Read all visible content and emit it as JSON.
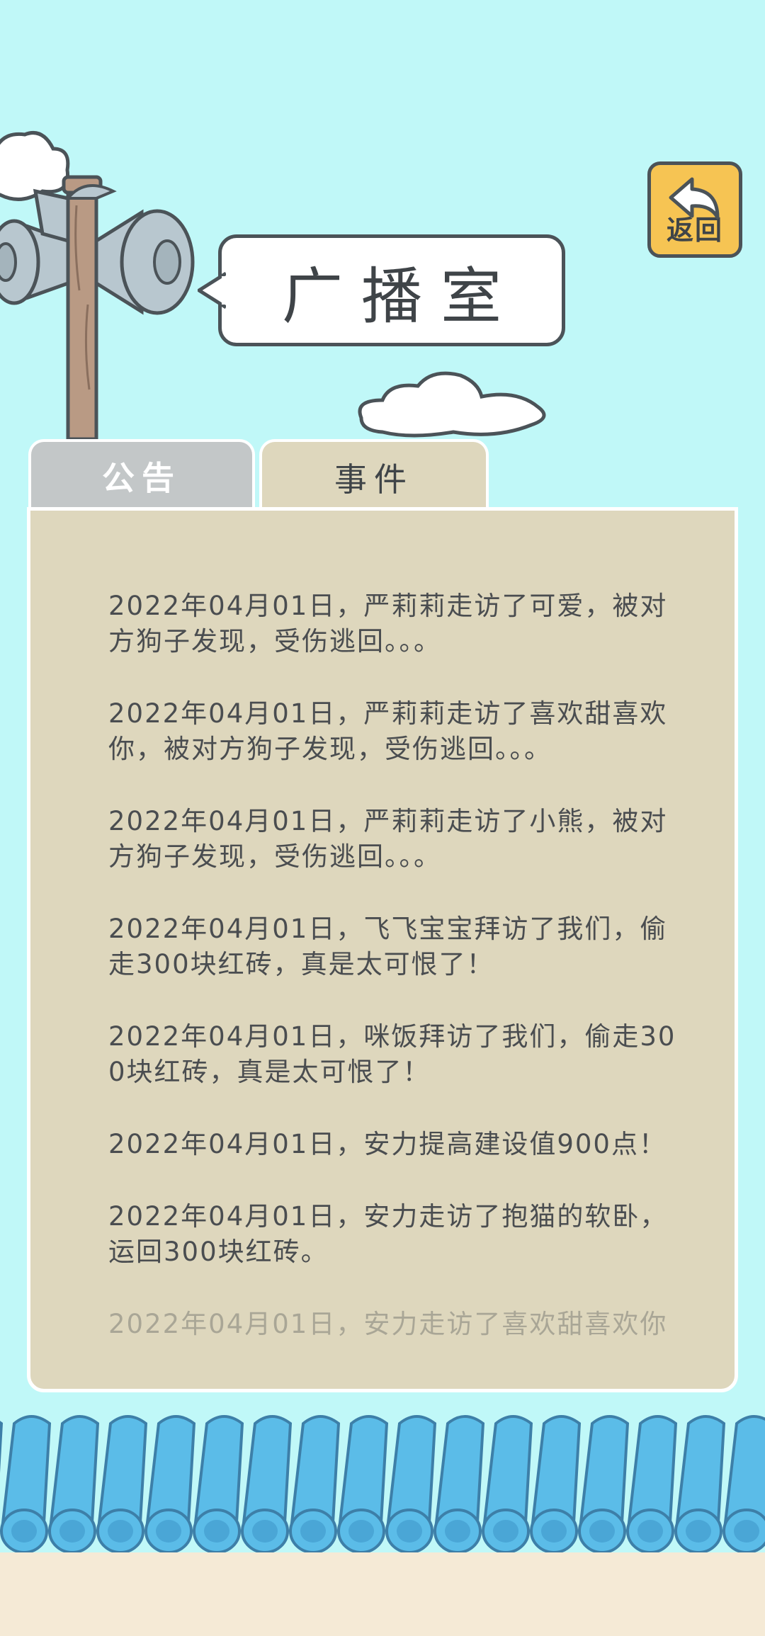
{
  "header": {
    "title": "广播室",
    "back_label": "返回"
  },
  "tabs": [
    {
      "label": "公告",
      "active": false
    },
    {
      "label": "事件",
      "active": true
    }
  ],
  "events": [
    "2022年04月01日，严莉莉走访了可爱，被对方狗子发现，受伤逃回。。。",
    "2022年04月01日，严莉莉走访了喜欢甜喜欢你，被对方狗子发现，受伤逃回。。。",
    "2022年04月01日，严莉莉走访了小熊，被对方狗子发现，受伤逃回。。。",
    "2022年04月01日，飞飞宝宝拜访了我们，偷走300块红砖，真是太可恨了！",
    "2022年04月01日，咪饭拜访了我们，偷走300块红砖，真是太可恨了！",
    "2022年04月01日，安力提高建设值900点！",
    "2022年04月01日，安力走访了抱猫的软卧，运回300块红砖。",
    "2022年04月01日，安力走访了喜欢甜喜欢你"
  ],
  "colors": {
    "sky": "#c0f8f8",
    "panel": "#ded7bd",
    "roof_tile": "#5bbce8",
    "back_button": "#f6c453",
    "ground": "#f5ead6"
  },
  "icons": [
    "cloud-icon",
    "loudspeaker-icon",
    "back-arrow-icon"
  ]
}
